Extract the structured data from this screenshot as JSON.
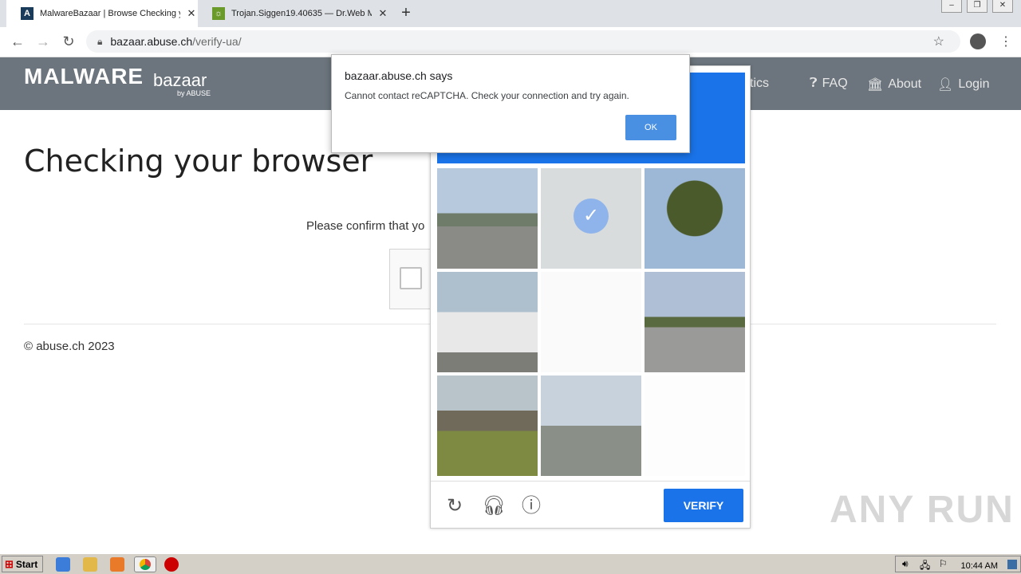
{
  "browser": {
    "tabs": [
      {
        "title": "MalwareBazaar | Browse Checking y",
        "active": true
      },
      {
        "title": "Trojan.Siggen19.40635 — Dr.Web M",
        "active": false
      }
    ],
    "url_host": "bazaar.abuse.ch",
    "url_path": "/verify-ua/"
  },
  "site": {
    "logo_main": "MALWARE",
    "logo_sub": "bazaar",
    "logo_by": "by ABUSE",
    "nav": {
      "statistics": "Statistics",
      "faq": "FAQ",
      "about": "About",
      "login": "Login"
    }
  },
  "page": {
    "title": "Checking your browser",
    "confirm_text": "Please confirm that yo",
    "footer": "© abuse.ch 2023"
  },
  "captcha": {
    "verify_label": "VERIFY"
  },
  "dialog": {
    "title": "bazaar.abuse.ch says",
    "message": "Cannot contact reCAPTCHA. Check your connection and try again.",
    "ok_label": "OK"
  },
  "watermark": "ANY RUN",
  "taskbar": {
    "start_label": "Start",
    "clock": "10:44 AM"
  }
}
